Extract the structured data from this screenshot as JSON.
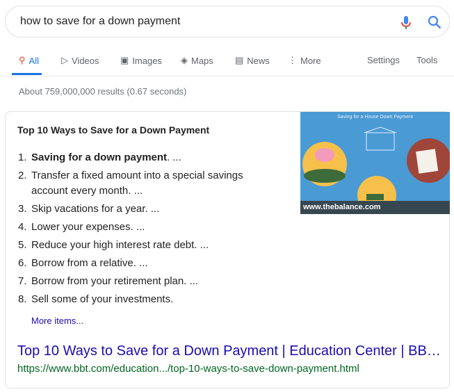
{
  "search": {
    "query": "how to save for a down payment",
    "mic_icon": "microphone-icon",
    "search_icon": "search-icon"
  },
  "tabs": [
    {
      "label": "All",
      "icon": "search-icon"
    },
    {
      "label": "Videos",
      "icon": "play-icon"
    },
    {
      "label": "Images",
      "icon": "image-icon"
    },
    {
      "label": "Maps",
      "icon": "map-icon"
    },
    {
      "label": "News",
      "icon": "news-icon"
    },
    {
      "label": "More",
      "icon": "more-vert-icon"
    }
  ],
  "tools": {
    "settings": "Settings",
    "tools": "Tools"
  },
  "stats": "About 759,000,000 results (0.67 seconds)",
  "snippet": {
    "title": "Top 10 Ways to Save for a Down Payment",
    "items": [
      {
        "num": "1.",
        "bold": "Saving for a down payment",
        "rest": ". ..."
      },
      {
        "num": "2.",
        "text": "Transfer a fixed amount into a special savings account every month. ..."
      },
      {
        "num": "3.",
        "text": "Skip vacations for a year. ..."
      },
      {
        "num": "4.",
        "text": "Lower your expenses. ..."
      },
      {
        "num": "5.",
        "text": "Reduce your high interest rate debt. ..."
      },
      {
        "num": "6.",
        "text": "Borrow from a relative. ..."
      },
      {
        "num": "7.",
        "text": "Borrow from your retirement plan. ..."
      },
      {
        "num": "8.",
        "text": "Sell some of your investments."
      }
    ],
    "more_items": "More items...",
    "image": {
      "title": "Saving for a House Down Payment",
      "caption": "www.thebalance.com"
    },
    "link_title": "Top 10 Ways to Save for a Down Payment | Education Center | BB…",
    "url": "https://www.bbt.com/education.../top-10-ways-to-save-down-payment.html"
  }
}
